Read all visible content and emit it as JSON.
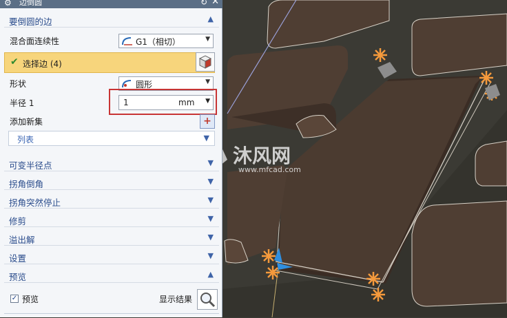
{
  "dialog": {
    "title": "边倒圆",
    "title_icon": "gear-icon",
    "reset_icon": "reset-icon",
    "close_icon": "close-icon"
  },
  "edge_section": {
    "title": "要倒圆的边",
    "continuity_label": "混合面连续性",
    "continuity_value": "G1（相切）",
    "select_edge_label": "选择边 (4)",
    "shape_label": "形状",
    "shape_value": "圆形",
    "radius_label": "半径 1",
    "radius_value": "1",
    "radius_unit": "mm",
    "add_set_label": "添加新集",
    "list_label": "列表"
  },
  "sections": [
    {
      "label": "可变半径点"
    },
    {
      "label": "拐角倒角"
    },
    {
      "label": "拐角突然停止"
    },
    {
      "label": "修剪"
    },
    {
      "label": "溢出解"
    },
    {
      "label": "设置"
    }
  ],
  "preview_section": {
    "title": "预览",
    "checkbox_label": "预览",
    "checked": true,
    "show_result_label": "显示结果"
  },
  "watermark": {
    "text": "沐风网",
    "url": "www.mfcad.com"
  },
  "colors": {
    "viewport_bg": "#3b3a34",
    "block": "#4f3e33",
    "selected_row": "#f7d57c",
    "highlight_box": "#c83434",
    "marker": "#f59a3c"
  }
}
